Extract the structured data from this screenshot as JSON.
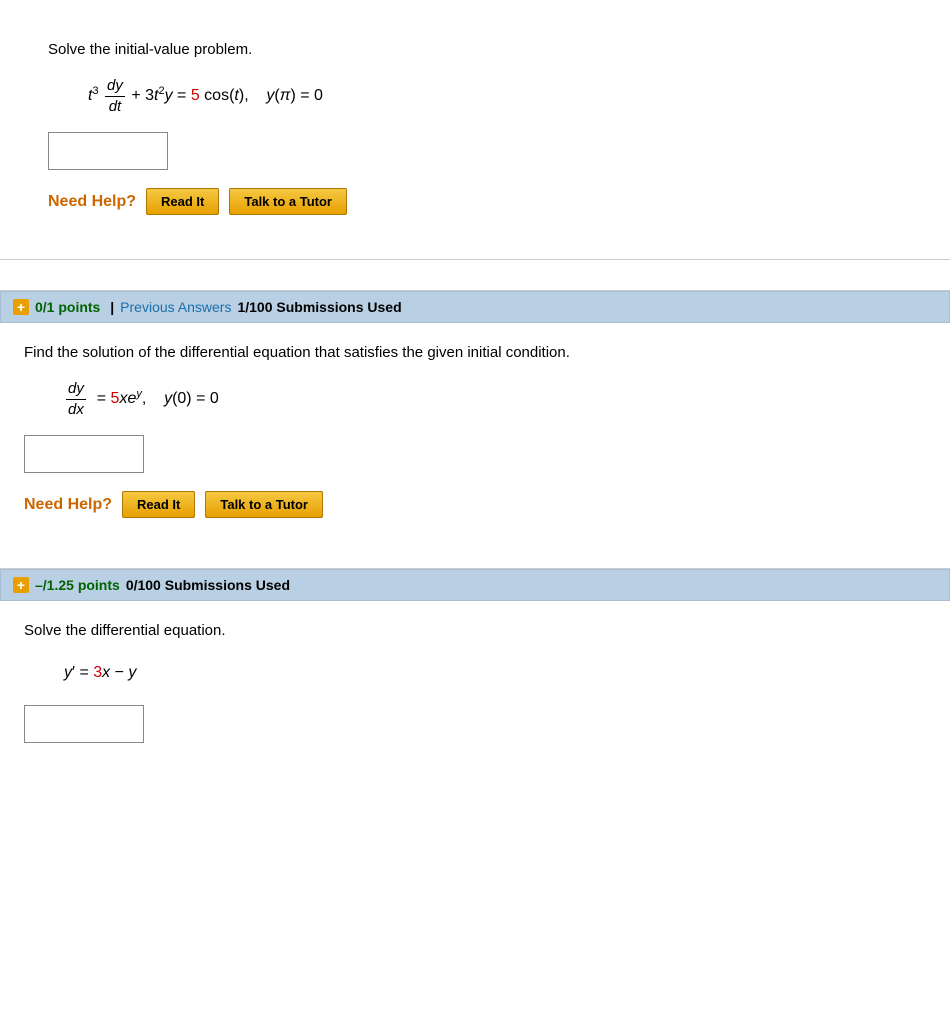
{
  "sections": [
    {
      "id": "section1",
      "type": "no-header",
      "problem_text": "Solve the initial-value problem.",
      "equation_display": "t³(dy/dt) + 3t²y = 5 cos(t),   y(π) = 0",
      "need_help_label": "Need Help?",
      "buttons": [
        "Read It",
        "Talk to a Tutor"
      ]
    },
    {
      "id": "section2",
      "type": "with-header",
      "header": {
        "points": "0/1 points",
        "separator": "|",
        "prev_answers": "Previous Answers",
        "submissions": "1/100 Submissions Used"
      },
      "problem_text": "Find the solution of the differential equation that satisfies the given initial condition.",
      "need_help_label": "Need Help?",
      "buttons": [
        "Read It",
        "Talk to a Tutor"
      ]
    },
    {
      "id": "section3",
      "type": "with-header",
      "header": {
        "points": "–/1.25 points",
        "submissions": "0/100 Submissions Used"
      },
      "problem_text": "Solve the differential equation.",
      "need_help_label": "Need Help?",
      "buttons": [
        "Read It",
        "Talk to a Tutor"
      ]
    }
  ],
  "labels": {
    "need_help": "Need Help?",
    "read_it": "Read It",
    "talk_to_tutor": "Talk to a Tutor",
    "previous_answers": "Previous Answers"
  }
}
